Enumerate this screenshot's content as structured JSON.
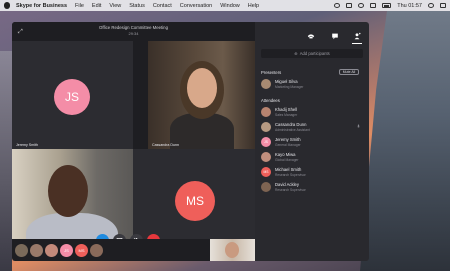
{
  "menubar": {
    "app_name": "Skype for Business",
    "items": [
      "File",
      "Edit",
      "View",
      "Status",
      "Contact",
      "Conversation",
      "Window",
      "Help"
    ],
    "clock": "Thu 01:57"
  },
  "meeting": {
    "title": "Office Redesign Committee Meeting",
    "duration": "29:34",
    "tiles": {
      "jeremy": {
        "initials": "JS",
        "name": "Jeremy Smith",
        "color": "#f48da7"
      },
      "cassandra": {
        "name": "Cassandra Dunn"
      },
      "curtis": {
        "name": "Curtis Ackley"
      },
      "michael": {
        "initials": "MS",
        "name": "Michael Smith",
        "color": "#ef5f5a"
      }
    },
    "controls": {
      "video": "video-icon",
      "share": "screen-share-icon",
      "mute": "mute-icon",
      "hangup": "hang-up-icon",
      "hangup_color": "#e5373c",
      "accent": "#1f8be0"
    },
    "strip_avatars": [
      {
        "initials": "",
        "color": "#7a6a5a"
      },
      {
        "initials": "",
        "color": "#9a7a6a"
      },
      {
        "initials": "",
        "color": "#c48a7a"
      },
      {
        "initials": "JS",
        "color": "#f48da7"
      },
      {
        "initials": "MS",
        "color": "#ef5f5a"
      },
      {
        "initials": "",
        "color": "#8a6a5a"
      }
    ]
  },
  "panel": {
    "add_participants_placeholder": "Add participants",
    "presenters_heading": "Presenters",
    "mute_all_label": "Mute All",
    "attendees_heading": "Attendees",
    "presenters": [
      {
        "name": "Miguel Silva",
        "role": "Marketing Manager",
        "initials": "",
        "color": "#a88a72"
      }
    ],
    "attendees": [
      {
        "name": "Khadij Shell",
        "role": "Sales Manager",
        "initials": "",
        "color": "#b88470"
      },
      {
        "name": "Cassandra Dunn",
        "role": "Administrative Assistant",
        "initials": "",
        "color": "#b79a82"
      },
      {
        "name": "Jeremy Smith",
        "role": "General Manager",
        "initials": "JS",
        "color": "#f48da7"
      },
      {
        "name": "Kayo Miwa",
        "role": "Global Manager",
        "initials": "",
        "color": "#c08e7d"
      },
      {
        "name": "Michael Smith",
        "role": "Research Supervisor",
        "initials": "MS",
        "color": "#ef5f5a"
      },
      {
        "name": "David Ackley",
        "role": "Research Supervisor",
        "initials": "",
        "color": "#7e6452"
      }
    ]
  }
}
